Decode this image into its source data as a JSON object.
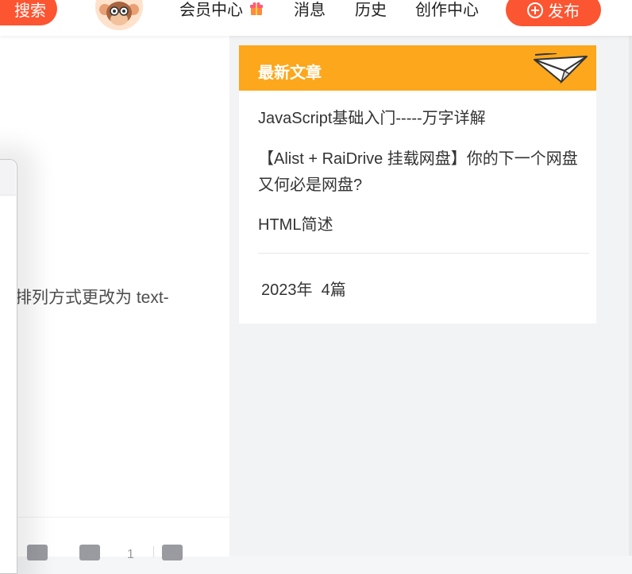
{
  "header": {
    "search_label": "搜索",
    "nav": [
      "会员中心",
      "消息",
      "历史",
      "创作中心"
    ],
    "publish_label": "发布"
  },
  "article": {
    "visible_text": "排列方式更改为 text-",
    "comment_count": "1"
  },
  "sidebar": {
    "latest": {
      "title": "最新文章",
      "items": [
        "JavaScript基础入门-----万字详解",
        "【Alist + RaiDrive 挂载网盘】你的下一个网盘又何必是网盘?",
        "HTML简述"
      ],
      "archive": "2023年  4篇"
    }
  },
  "colors": {
    "brand": "#fc5531",
    "card_header": "#fca71c"
  }
}
